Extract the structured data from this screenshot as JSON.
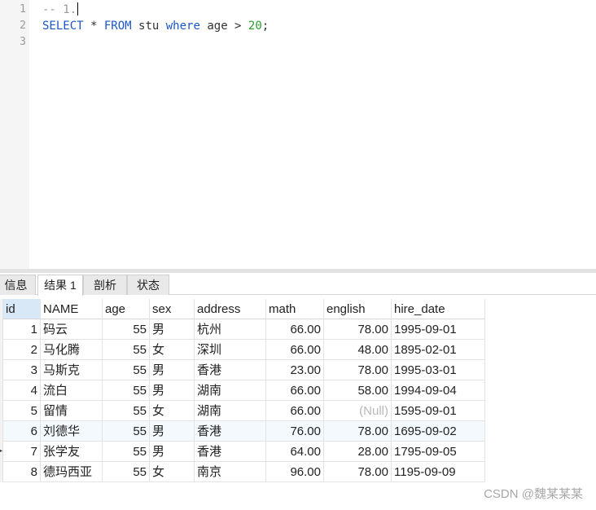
{
  "editor": {
    "line_numbers": [
      "1",
      "2",
      "3"
    ],
    "line1": "-- 1.",
    "line2": {
      "select": "SELECT",
      "star": " * ",
      "from": "FROM",
      "table": " stu ",
      "where": "where",
      "cond": " age > ",
      "num": "20",
      "semi": ";"
    }
  },
  "tabs": [
    "信息",
    "结果 1",
    "剖析",
    "状态"
  ],
  "grid": {
    "columns": [
      "id",
      "NAME",
      "age",
      "sex",
      "address",
      "math",
      "english",
      "hire_date"
    ],
    "rows": [
      [
        "1",
        "码云",
        "55",
        "男",
        "杭州",
        "66.00",
        "78.00",
        "1995-09-01"
      ],
      [
        "2",
        "马化腾",
        "55",
        "女",
        "深圳",
        "66.00",
        "48.00",
        "1895-02-01"
      ],
      [
        "3",
        "马斯克",
        "55",
        "男",
        "香港",
        "23.00",
        "78.00",
        "1995-03-01"
      ],
      [
        "4",
        "流白",
        "55",
        "男",
        "湖南",
        "66.00",
        "58.00",
        "1994-09-04"
      ],
      [
        "5",
        "留情",
        "55",
        "女",
        "湖南",
        "66.00",
        "(Null)",
        "1595-09-01"
      ],
      [
        "6",
        "刘德华",
        "55",
        "男",
        "香港",
        "76.00",
        "78.00",
        "1695-09-02"
      ],
      [
        "7",
        "张学友",
        "55",
        "男",
        "香港",
        "64.00",
        "28.00",
        "1795-09-05"
      ],
      [
        "8",
        "德玛西亚",
        "55",
        "女",
        "南京",
        "96.00",
        "78.00",
        "1195-09-09"
      ]
    ]
  },
  "watermark": "CSDN @魏某某某"
}
